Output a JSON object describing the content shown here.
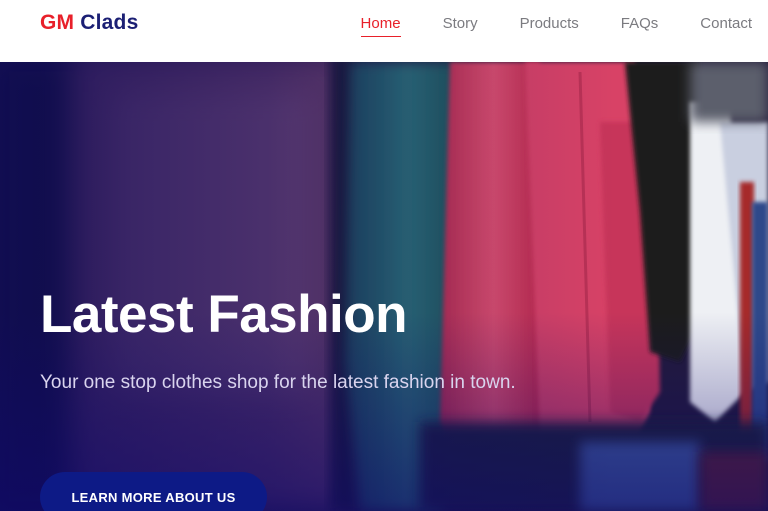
{
  "brand": {
    "part1": "GM",
    "part2": "Clads"
  },
  "nav": {
    "items": [
      {
        "label": "Home",
        "active": true
      },
      {
        "label": "Story",
        "active": false
      },
      {
        "label": "Products",
        "active": false
      },
      {
        "label": "FAQs",
        "active": false
      },
      {
        "label": "Contact",
        "active": false
      }
    ]
  },
  "hero": {
    "title": "Latest Fashion",
    "subtitle": "Your one stop clothes shop for the latest fashion in town.",
    "button_label": "LEARN MORE ABOUT US"
  },
  "colors": {
    "brand_red": "#e8202a",
    "brand_navy": "#1b1f74",
    "button_blue": "#0d1a86"
  }
}
